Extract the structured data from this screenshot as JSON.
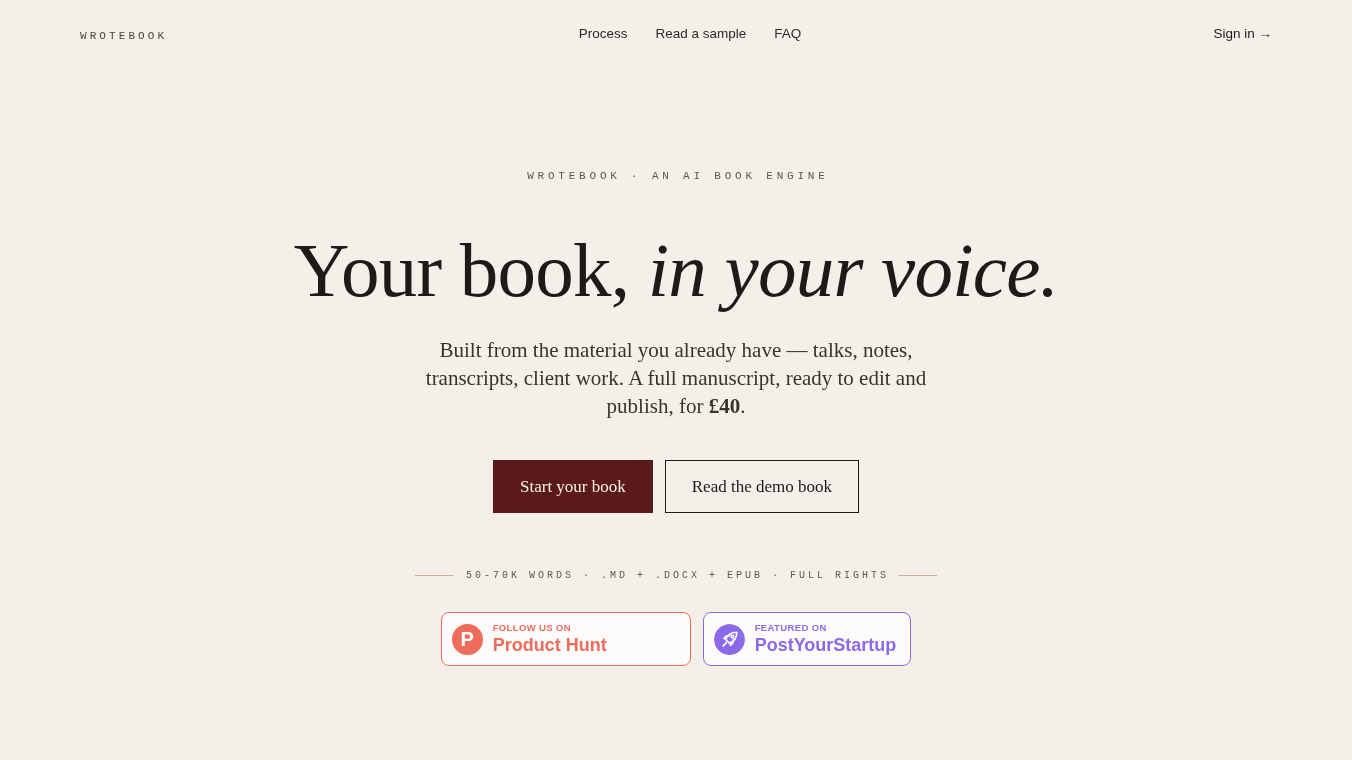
{
  "nav": {
    "logo": "WROTEBOOK",
    "links": [
      "Process",
      "Read a sample",
      "FAQ"
    ],
    "sign_in": "Sign in →"
  },
  "hero": {
    "eyebrow": "WROTEBOOK · AN AI BOOK ENGINE",
    "headline": "Your book, *in your voice.*",
    "lede": "Built from the material you already have — talks, notes, transcripts, client work. A full manuscript, ready to edit and publish, for **£40**.",
    "buttons": [
      {
        "label": "Start your book",
        "kind": "primary"
      },
      {
        "label": "Read the demo book",
        "kind": "outline"
      }
    ],
    "specs": "50-70K WORDS · .MD + .DOCX + EPUB · FULL RIGHTS"
  },
  "badges": [
    {
      "kind": "letter",
      "letter": "P",
      "kicker": "FOLLOW US ON",
      "name": "Product Hunt",
      "color": "#ef6b5b"
    },
    {
      "kind": "rocket",
      "kicker": "FEATURED ON",
      "name": "PostYourStartup",
      "color": "#8c69e6"
    }
  ]
}
